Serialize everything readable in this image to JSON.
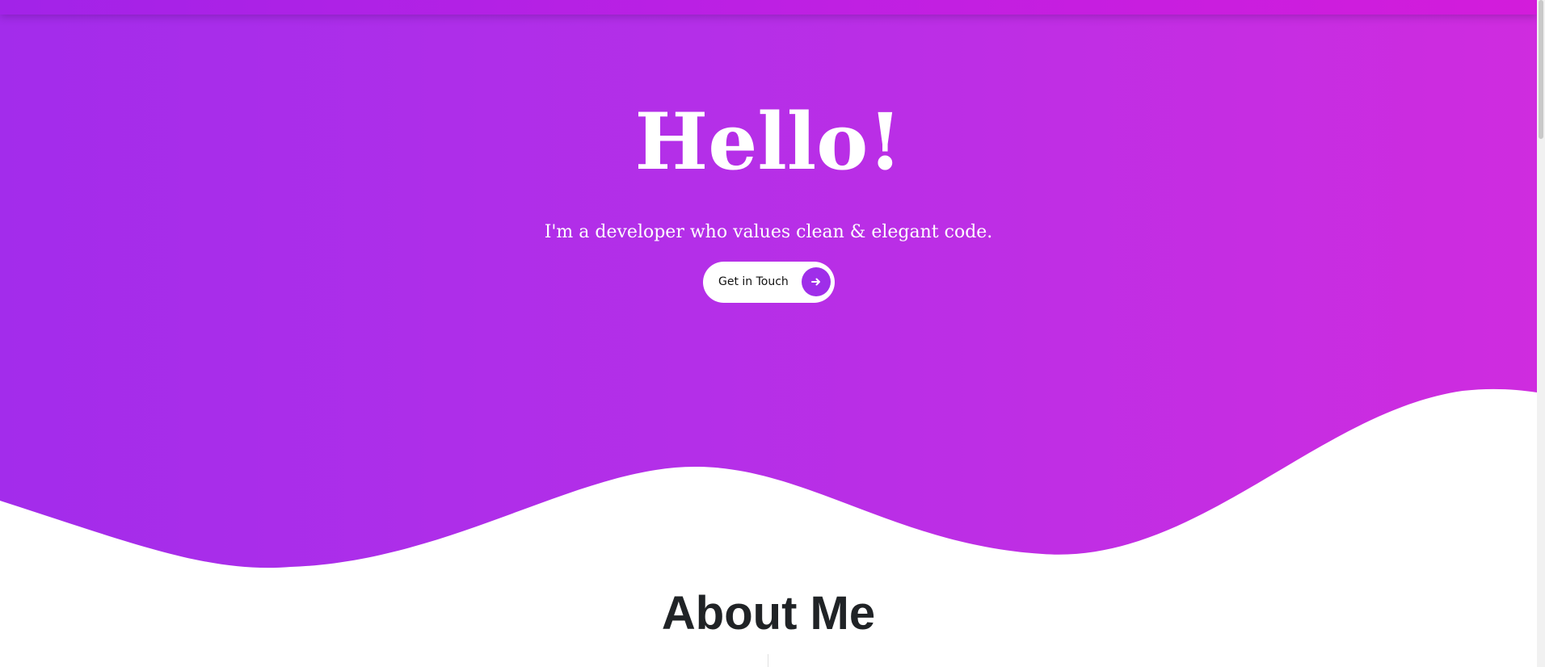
{
  "hero": {
    "title": "Hello!",
    "subtitle": "I'm a developer who values clean & elegant code.",
    "cta_label": "Get in Touch",
    "cta_icon": "arrow-right-icon"
  },
  "about": {
    "title": "About Me"
  },
  "theme": {
    "gradient_start": "#a32ceb",
    "gradient_end": "#cf2cdf",
    "accent": "#9f2ee9",
    "heading_text": "#202326"
  }
}
